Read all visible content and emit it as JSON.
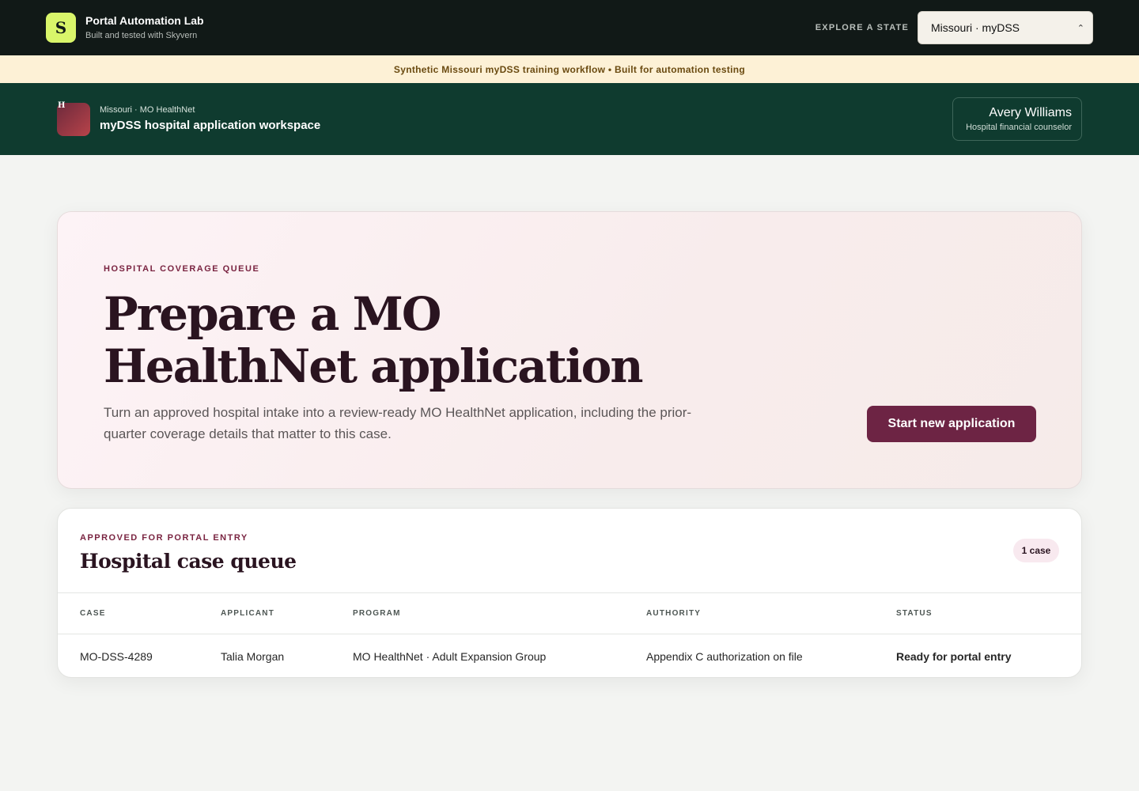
{
  "lab": {
    "logo_letter": "S",
    "title": "Portal Automation Lab",
    "subtitle": "Built and tested with Skyvern",
    "explore_label": "EXPLORE A STATE",
    "state_selected": "Missouri · myDSS",
    "accent_color": "#d9f56a"
  },
  "notice": {
    "text": "Synthetic Missouri myDSS training workflow • Built for automation testing"
  },
  "agency": {
    "logo_letter": "H",
    "subtitle": "Missouri · MO HealthNet",
    "title": "myDSS hospital application workspace",
    "user_name": "Avery Williams",
    "user_role": "Hospital financial counselor",
    "brand_color": "#0f3b2f"
  },
  "hero": {
    "eyebrow": "HOSPITAL COVERAGE QUEUE",
    "title": "Prepare a MO HealthNet application",
    "description": "Turn an approved hospital intake into a review-ready MO HealthNet application, including the prior-quarter coverage details that matter to this case.",
    "button_label": "Start new application",
    "button_color": "#6d2444"
  },
  "queue": {
    "eyebrow": "APPROVED FOR PORTAL ENTRY",
    "title": "Hospital case queue",
    "count_badge": "1 case",
    "columns": [
      "CASE",
      "APPLICANT",
      "PROGRAM",
      "AUTHORITY",
      "STATUS"
    ],
    "rows": [
      {
        "case": "MO-DSS-4289",
        "applicant": "Talia Morgan",
        "program": "MO HealthNet · Adult Expansion Group",
        "authority": "Appendix C authorization on file",
        "status": "Ready for portal entry"
      }
    ]
  }
}
